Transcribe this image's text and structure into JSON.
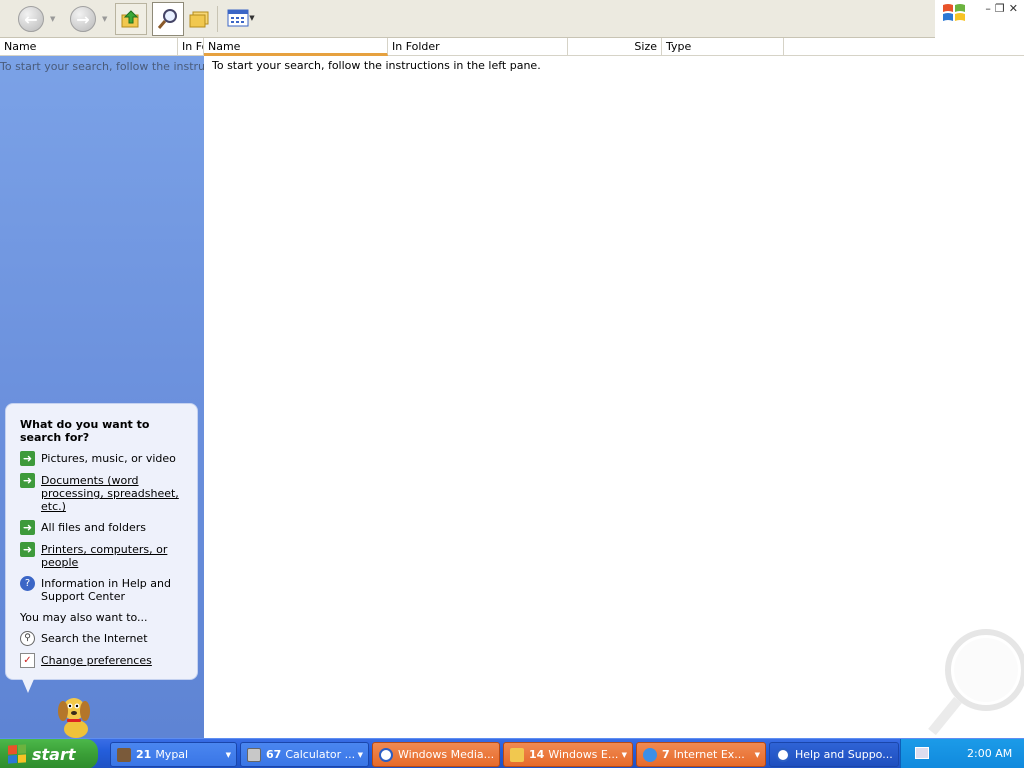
{
  "toolbar": {
    "back_icon": "back-arrow-icon",
    "forward_icon": "forward-arrow-icon",
    "up_icon": "folder-up-icon",
    "search_icon": "search-magnifier-icon",
    "folders_icon": "folders-icon",
    "views_icon": "views-icon"
  },
  "columns": {
    "left_name": "Name",
    "left_in_folder": "In Fo",
    "name": "Name",
    "in_folder": "In Folder",
    "size": "Size",
    "type": "Type"
  },
  "left_pane": {
    "ghost_text": "To start your search, follow the instructions",
    "search_title": "What do you want to search for?",
    "options": [
      {
        "label": "Pictures, music, or video",
        "icon": "green-arrow-icon"
      },
      {
        "label": "Documents (word processing, spreadsheet, etc.)",
        "icon": "green-arrow-icon"
      },
      {
        "label": "All files and folders",
        "icon": "green-arrow-icon"
      },
      {
        "label": "Printers, computers, or people",
        "icon": "green-arrow-icon"
      },
      {
        "label": "Information in Help and Support Center",
        "icon": "help-icon"
      }
    ],
    "also_label": "You may also want to...",
    "also_options": [
      {
        "label": "Search the Internet",
        "icon": "internet-search-icon"
      },
      {
        "label": "Change preferences",
        "icon": "preferences-icon"
      }
    ]
  },
  "results": {
    "message": "To start your search, follow the instructions in the left pane."
  },
  "taskbar": {
    "start_label": "start",
    "tasks": [
      {
        "count": "21",
        "label": "Mypal",
        "icon": "mypal-icon"
      },
      {
        "count": "67",
        "label": "Calculator ...",
        "icon": "calculator-icon"
      },
      {
        "count": "",
        "label": "Windows Media...",
        "icon": "media-player-icon"
      },
      {
        "count": "14",
        "label": "Windows E...",
        "icon": "folder-icon"
      },
      {
        "count": "7",
        "label": "Internet Ex...",
        "icon": "internet-explorer-icon"
      },
      {
        "count": "",
        "label": "Help and Suppo...",
        "icon": "help-icon"
      }
    ],
    "clock": "2:00 AM"
  },
  "colors": {
    "left_pane_top": "#7ba2e7",
    "left_pane_bottom": "#5e84d4",
    "taskbar": "#245edb",
    "start_green": "#3a9f37",
    "sorted_column_accent": "#e6a13f",
    "task_orange": "#e66a2a"
  }
}
